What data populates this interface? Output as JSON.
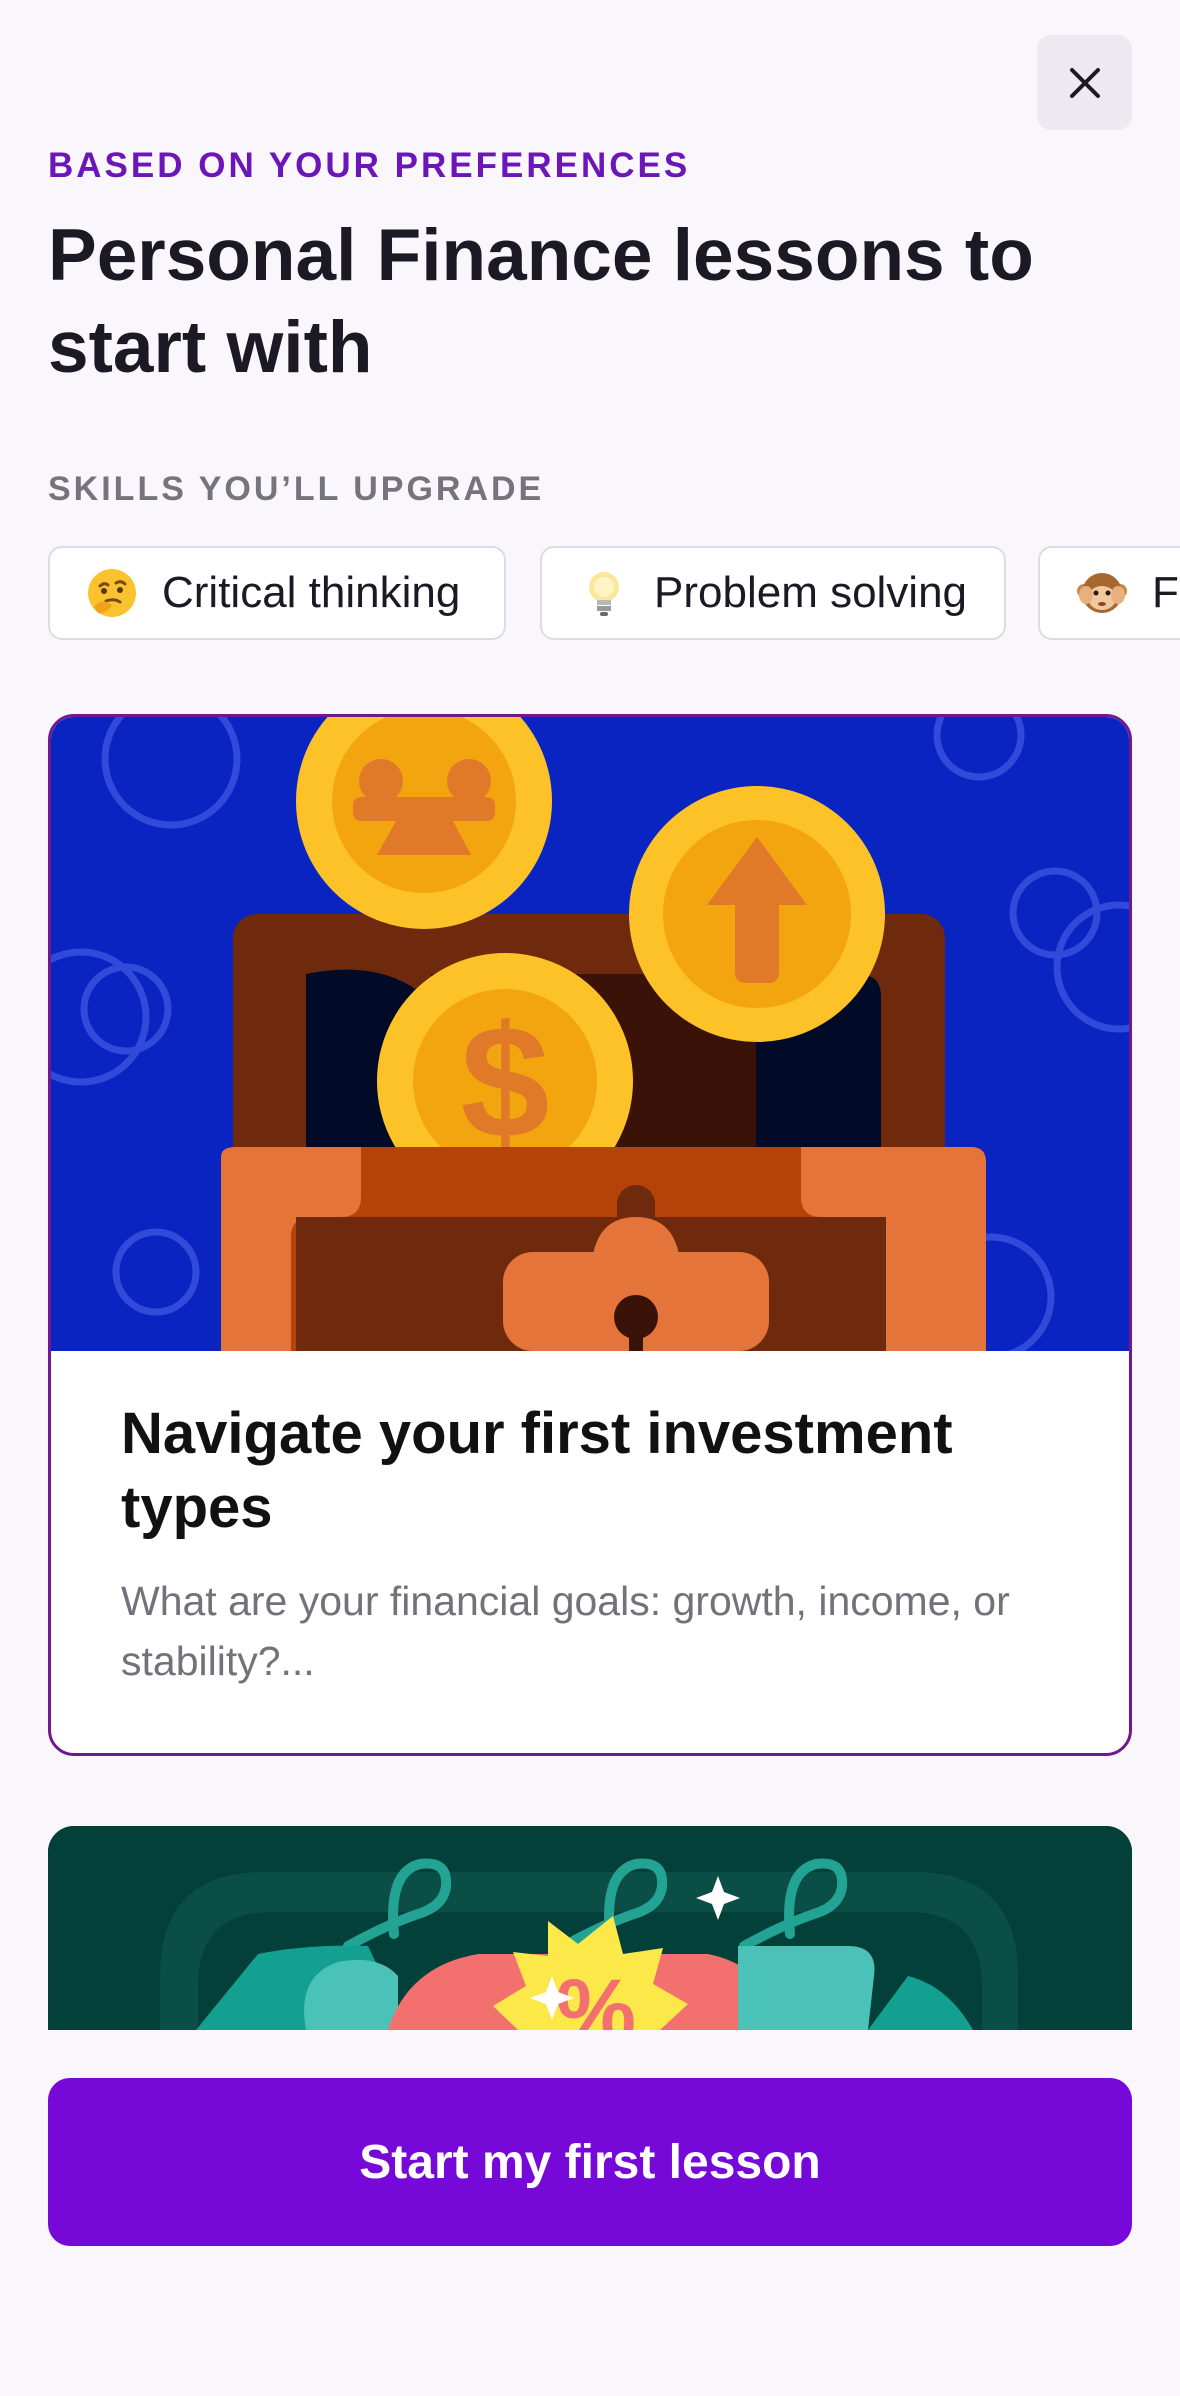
{
  "header": {
    "close_icon": "close-icon",
    "eyebrow": "BASED ON YOUR PREFERENCES",
    "title": "Personal Finance lessons to start with"
  },
  "skills": {
    "label": "SKILLS YOU’LL UPGRADE",
    "items": [
      {
        "icon": "thinking-face-icon",
        "label": "Critical thinking"
      },
      {
        "icon": "light-bulb-icon",
        "label": "Problem solving"
      },
      {
        "icon": "monkey-face-icon",
        "label": "Fo"
      }
    ]
  },
  "lessons": [
    {
      "illustration": "treasure-chest-coins-illustration",
      "title": "Navigate your first investment types",
      "description": "What are your financial goals: growth, income, or stability?..."
    },
    {
      "illustration": "clothing-hangers-discount-illustration"
    }
  ],
  "footer": {
    "cta_label": "Start my first lesson"
  },
  "colors": {
    "accent": "#7608d8",
    "eyebrow": "#6c16b8",
    "card_border": "#70198f",
    "card_art_bg": "#0a24c1",
    "card2_bg": "#04403a"
  }
}
